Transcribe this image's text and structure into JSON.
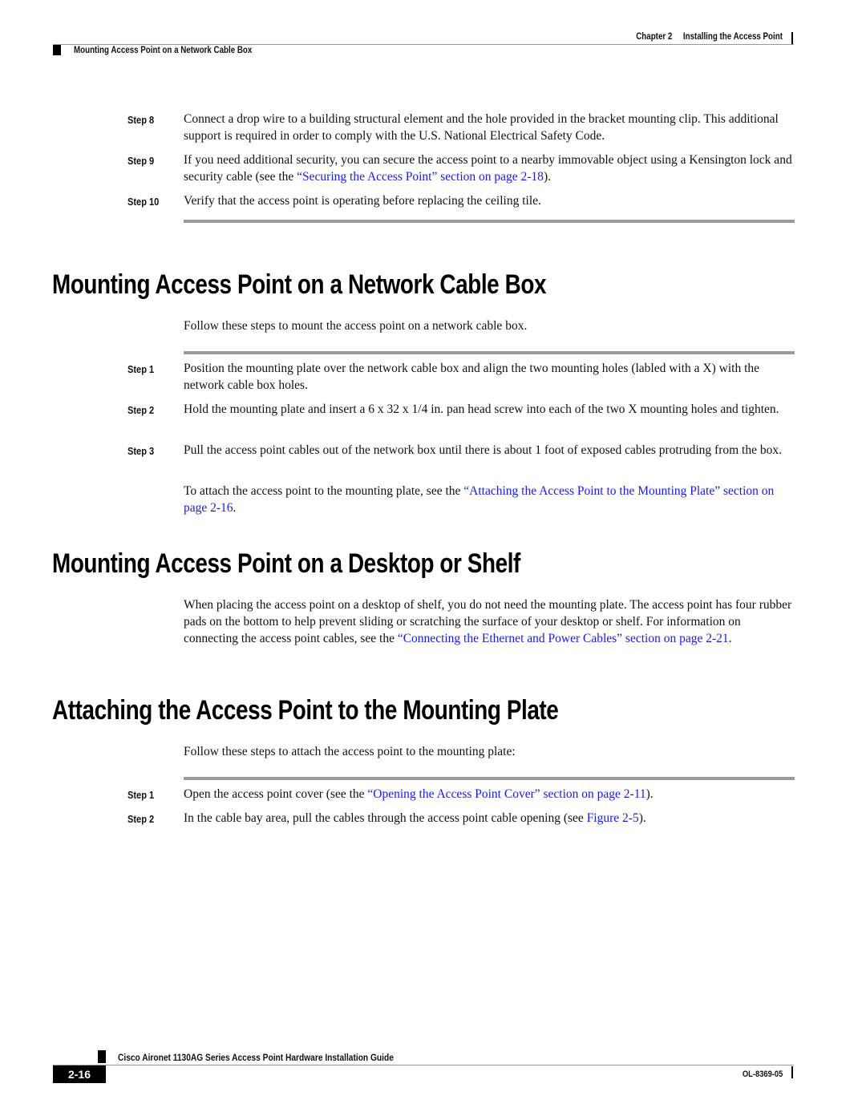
{
  "header": {
    "chapter": "Chapter 2",
    "chapter_title": "Installing the Access Point",
    "section": "Mounting Access Point on a Network Cable Box"
  },
  "prev_steps": [
    {
      "label": "Step 8",
      "text": "Connect a drop wire to a building structural element and the hole provided in the bracket mounting clip. This additional support is required in order to comply with the U.S. National Electrical Safety Code."
    },
    {
      "label": "Step 9",
      "text_before": "If you need additional security, you can secure the access point to a nearby immovable object using a Kensington lock and security cable (see the ",
      "link": "“Securing the Access Point” section on page 2-18",
      "text_after": ")."
    },
    {
      "label": "Step 10",
      "text": "Verify that the access point is operating before replacing the ceiling tile."
    }
  ],
  "section1": {
    "title": "Mounting Access Point on a Network Cable Box",
    "intro": "Follow these steps to mount the access point on a network cable box.",
    "steps": [
      {
        "label": "Step 1",
        "text": "Position the mounting plate over the network cable box and align the two mounting holes (labled with a X) with the network cable box holes."
      },
      {
        "label": "Step 2",
        "text": "Hold the mounting plate and insert a 6 x 32 x 1/4 in. pan head screw into each of the two X mounting holes and tighten."
      },
      {
        "label": "Step 3",
        "text": "Pull the access point cables out of the network box until there is about 1 foot of exposed cables protruding from the box."
      }
    ],
    "note_before": "To attach the access point to the mounting plate, see the ",
    "note_link": "“Attaching the Access Point to the Mounting Plate” section on page 2-16",
    "note_after": "."
  },
  "section2": {
    "title": "Mounting Access Point on a Desktop or Shelf",
    "text_before": "When placing the access point on a desktop of shelf, you do not need the mounting plate. The access point has four rubber pads on the bottom to help prevent sliding or scratching the surface of your desktop or shelf. For information on connecting the access point cables, see the ",
    "link": "“Connecting the Ethernet and Power Cables” section on page 2-21",
    "text_after": "."
  },
  "section3": {
    "title": "Attaching the Access Point to the Mounting Plate",
    "intro": "Follow these steps to attach the access point to the mounting plate:",
    "steps": [
      {
        "label": "Step 1",
        "text_before": "Open the access point cover (see the ",
        "link": "“Opening the Access Point Cover” section on page 2-11",
        "text_after": ")."
      },
      {
        "label": "Step 2",
        "text_before": "In the cable bay area, pull the cables through the access point cable opening (see ",
        "link": "Figure 2-5",
        "text_after": ")."
      }
    ]
  },
  "footer": {
    "guide_title": "Cisco Aironet 1130AG Series Access Point Hardware Installation Guide",
    "page_number": "2-16",
    "doc_number": "OL-8369-05"
  }
}
